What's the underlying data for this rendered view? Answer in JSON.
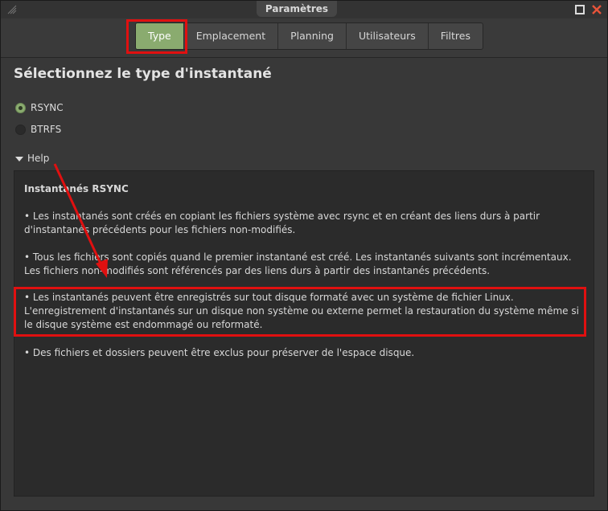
{
  "window": {
    "title": "Paramètres"
  },
  "tabs": [
    {
      "label": "Type",
      "active": true
    },
    {
      "label": "Emplacement",
      "active": false
    },
    {
      "label": "Planning",
      "active": false
    },
    {
      "label": "Utilisateurs",
      "active": false
    },
    {
      "label": "Filtres",
      "active": false
    }
  ],
  "main": {
    "heading": "Sélectionnez le type d'instantané",
    "options": [
      {
        "label": "RSYNC",
        "checked": true
      },
      {
        "label": "BTRFS",
        "checked": false
      }
    ],
    "help_label": "Help",
    "help": {
      "title": "Instantanés RSYNC",
      "paragraphs": [
        "• Les instantanés sont créés en copiant les fichiers système avec rsync et en créant des liens durs à partir d'instantanés précédents pour les fichiers non-modifiés.",
        "• Tous les fichiers sont copiés quand le premier instantané est créé. Les instantanés suivants sont incrémentaux. Les fichiers non-modifiés sont référencés par des liens durs à partir des instantanés précédents.",
        "• Les instantanés peuvent être enregistrés sur tout disque formaté avec un système de fichier Linux. L'enregistrement d'instantanés sur un disque non système ou externe permet la restauration du système même si le disque système est endommagé ou reformaté.",
        "• Des fichiers et dossiers peuvent être exclus pour préserver de l'espace disque."
      ]
    }
  },
  "colors": {
    "accent": "#8aab6f",
    "annotation": "#e01010",
    "close": "#e8543a"
  }
}
